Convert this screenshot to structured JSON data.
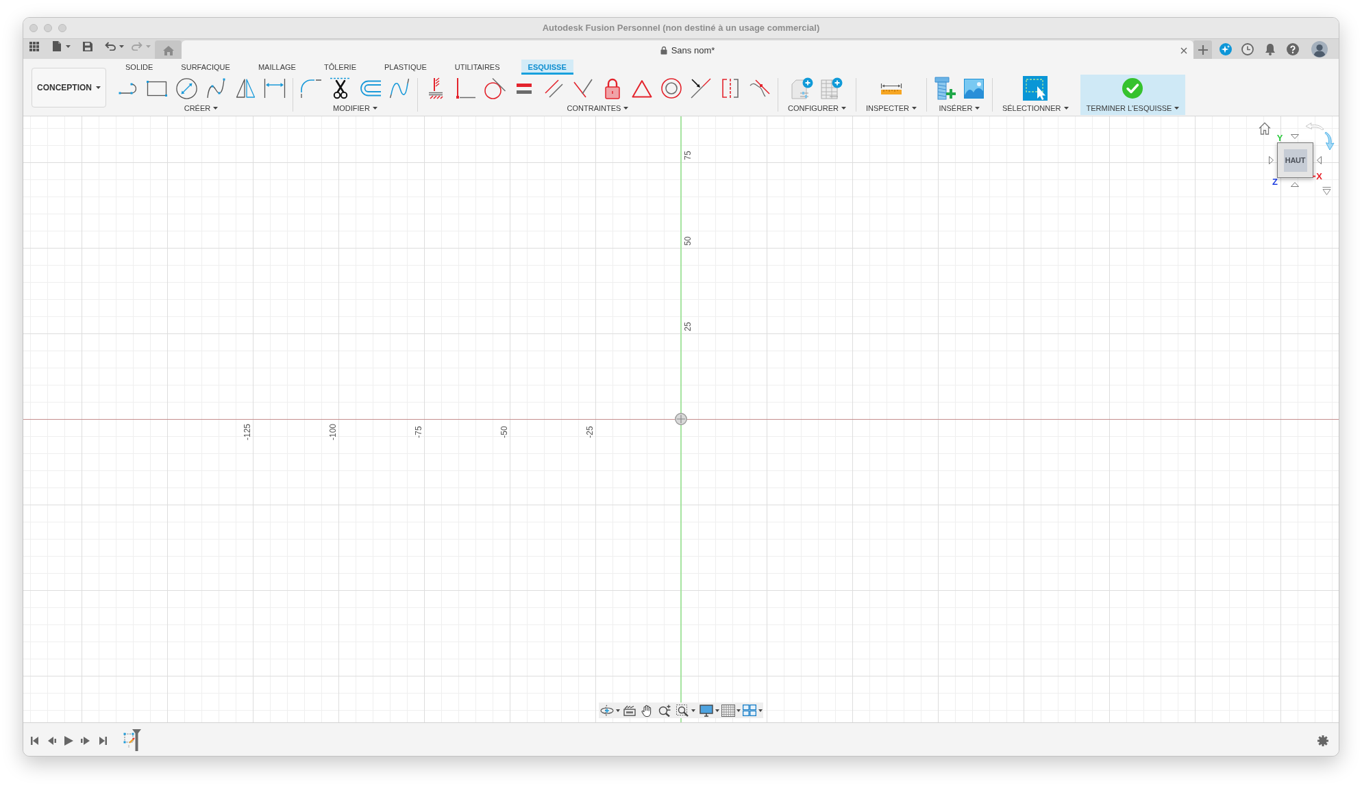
{
  "window": {
    "title": "Autodesk Fusion Personnel (non destiné à un usage commercial)"
  },
  "tabs": [
    {
      "kind": "home",
      "selected": false
    },
    {
      "kind": "document",
      "title": "Sans nom*",
      "selected": true
    }
  ],
  "workspace": {
    "label": "CONCEPTION"
  },
  "ribbon_tabs": [
    {
      "label": "SOLIDE",
      "selected": false
    },
    {
      "label": "SURFACIQUE",
      "selected": false
    },
    {
      "label": "MAILLAGE",
      "selected": false
    },
    {
      "label": "TÔLERIE",
      "selected": false
    },
    {
      "label": "PLASTIQUE",
      "selected": false
    },
    {
      "label": "UTILITAIRES",
      "selected": false
    },
    {
      "label": "ESQUISSE",
      "selected": true
    }
  ],
  "tool_groups": [
    {
      "kind": "tools",
      "label": "CRÉER"
    },
    {
      "kind": "tools",
      "label": "MODIFIER"
    },
    {
      "kind": "tools",
      "label": "CONTRAINTES"
    },
    {
      "kind": "tools",
      "label": "CONFIGURER"
    },
    {
      "kind": "tools",
      "label": "INSPECTER"
    },
    {
      "kind": "tools",
      "label": "INSÉRER"
    },
    {
      "kind": "tools",
      "label": "SÉLECTIONNER"
    },
    {
      "kind": "finish",
      "label": "TERMINER L'ESQUISSE"
    }
  ],
  "canvas": {
    "vertical_axis_labels": [
      "75",
      "50",
      "25"
    ],
    "horizontal_axis_labels": [
      "-125",
      "-100",
      "-75",
      "-50",
      "-25"
    ]
  },
  "view_cube": {
    "face": "HAUT",
    "axes": [
      {
        "label": "Y",
        "color": "#2ecc40"
      },
      {
        "label": "X",
        "color": "#e8222b"
      },
      {
        "label": "Z",
        "color": "#1f3fe0"
      }
    ]
  }
}
